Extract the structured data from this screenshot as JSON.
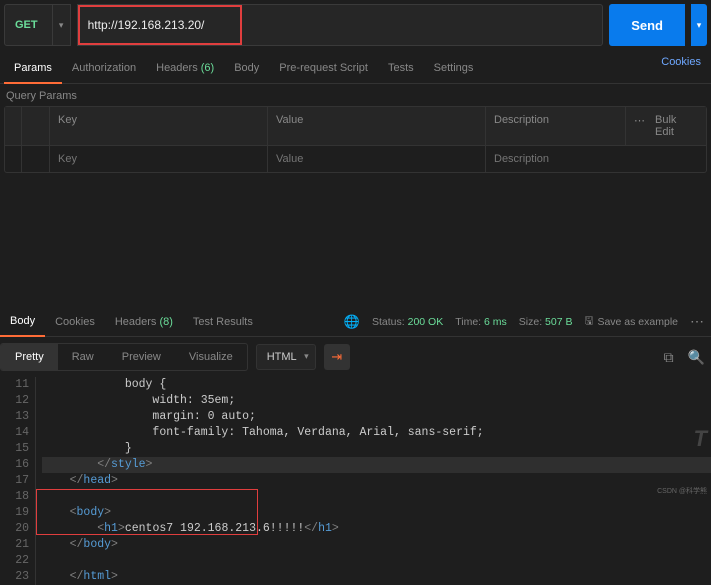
{
  "method": "GET",
  "url": "http://192.168.213.20/",
  "send_label": "Send",
  "req_tabs": [
    "Params",
    "Authorization",
    "Headers",
    "Body",
    "Pre-request Script",
    "Tests",
    "Settings"
  ],
  "headers_count": "(6)",
  "cookies_link": "Cookies",
  "query_params_label": "Query Params",
  "table": {
    "key": "Key",
    "value": "Value",
    "desc": "Description",
    "bulk": "Bulk Edit",
    "ph_key": "Key",
    "ph_value": "Value",
    "ph_desc": "Description"
  },
  "resp_tabs": [
    "Body",
    "Cookies",
    "Headers",
    "Test Results"
  ],
  "resp_headers_count": "(8)",
  "status": {
    "label": "Status:",
    "value": "200 OK"
  },
  "time": {
    "label": "Time:",
    "value": "6 ms"
  },
  "size": {
    "label": "Size:",
    "value": "507 B"
  },
  "save_example": "Save as example",
  "pretty_tabs": [
    "Pretty",
    "Raw",
    "Preview",
    "Visualize"
  ],
  "lang": "HTML",
  "code": {
    "l11": "            body {",
    "l12": "                width: 35em;",
    "l13": "                margin: 0 auto;",
    "l14": "                font-family: Tahoma, Verdana, Arial, sans-serif;",
    "l15": "            }",
    "l17": "head",
    "l19": "body",
    "l20_open": "h1",
    "l20_text": "centos7 192.168.213.6!!!!!",
    "l20_close": "h1",
    "l21": "body",
    "l23": "html",
    "style_close": "style"
  },
  "watermark_t": "T",
  "csdn": "CSDN @科学熊"
}
